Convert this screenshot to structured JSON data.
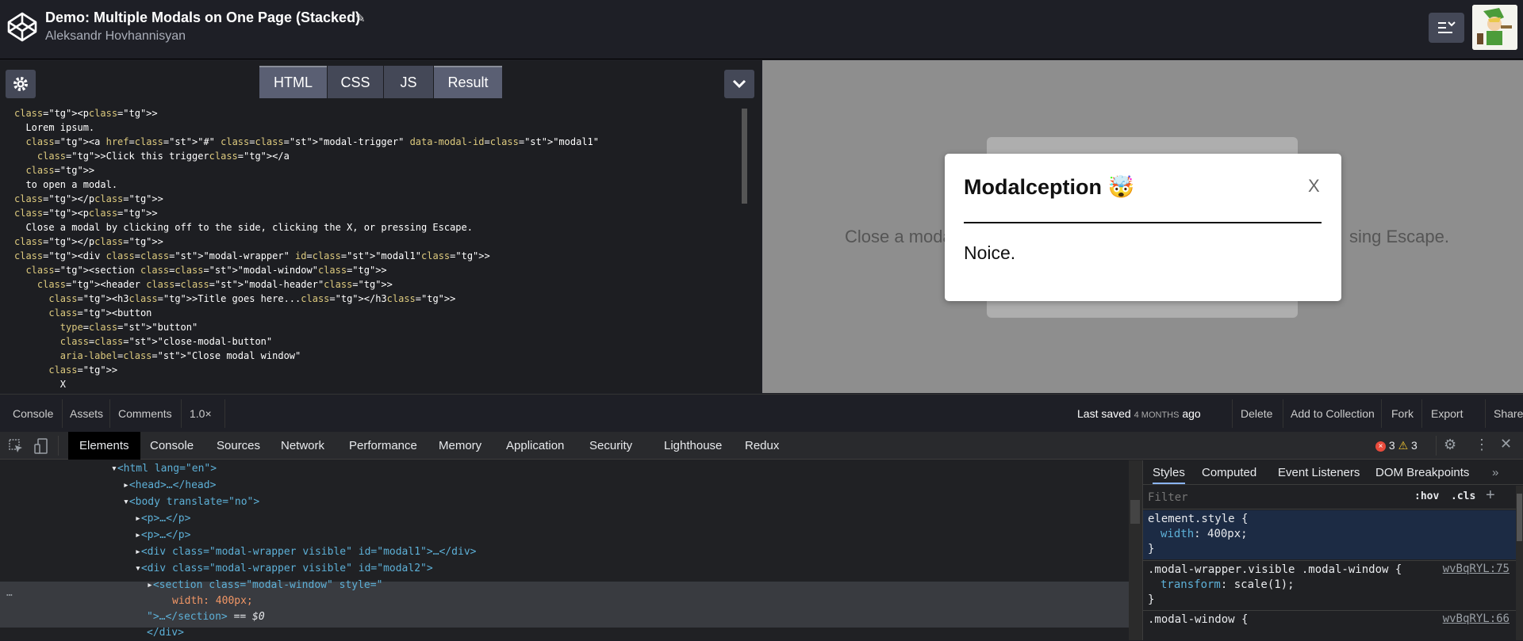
{
  "header": {
    "title": "Demo: Multiple Modals on One Page (Stacked)",
    "author": "Aleksandr Hovhannisyan"
  },
  "editor_tabs": [
    {
      "label": "HTML",
      "active": true
    },
    {
      "label": "CSS",
      "active": false
    },
    {
      "label": "JS",
      "active": false
    },
    {
      "label": "Result",
      "active": true
    }
  ],
  "code_lines": [
    "<p>",
    "  Lorem ipsum.",
    "  <a href=\"#\" class=\"modal-trigger\" data-modal-id=\"modal1\"",
    "    >Click this trigger</a",
    "  >",
    "  to open a modal.",
    "</p>",
    "<p>",
    "  Close a modal by clicking off to the side, clicking the X, or pressing Escape.",
    "</p>",
    "<div class=\"modal-wrapper\" id=\"modal1\">",
    "  <section class=\"modal-window\">",
    "    <header class=\"modal-header\">",
    "      <h3>Title goes here...</h3>",
    "      <button",
    "        type=\"button\"",
    "        class=\"close-modal-button\"",
    "        aria-label=\"Close modal window\"",
    "      >",
    "        X"
  ],
  "preview": {
    "bg_text_left": "Close a moda",
    "bg_text_right": "sing Escape.",
    "modal_title": "Modalception 🤯",
    "modal_close": "X",
    "modal_body": "Noice."
  },
  "bottombar": {
    "console": "Console",
    "assets": "Assets",
    "comments": "Comments",
    "zoom": "1.0×",
    "saved_prefix": "Last saved",
    "saved_time": "4 MONTHS",
    "saved_suffix": "ago",
    "delete": "Delete",
    "add_collection": "Add to Collection",
    "fork": "Fork",
    "export": "Export",
    "share": "Share"
  },
  "devtools": {
    "tabs": [
      "Elements",
      "Console",
      "Sources",
      "Network",
      "Performance",
      "Memory",
      "Application",
      "Security",
      "Lighthouse",
      "Redux"
    ],
    "errors": "3",
    "warnings": "3",
    "style_tabs": [
      "Styles",
      "Computed",
      "Event Listeners",
      "DOM Breakpoints"
    ],
    "filter_placeholder": "Filter",
    "hov": ":hov",
    "cls": ".cls",
    "dom": {
      "html_open": "<html lang=\"en\">",
      "head": "<head>…</head>",
      "body_open": "<body translate=\"no\">",
      "p1": "<p>…</p>",
      "p2": "<p>…</p>",
      "div1_a": "<div class=\"modal-wrapper visible\" id=\"modal1\">",
      "div1_b": "…</div>",
      "div2": "<div class=\"modal-wrapper visible\" id=\"modal2\">",
      "section_a": "<section class=\"modal-window\" style=\"",
      "section_b": "width: 400px;",
      "section_c": "\">…</section>",
      "section_d": "== $0",
      "div_close": "</div>"
    },
    "styles": {
      "r1_sel": "element.style {",
      "r1_prop": "width",
      "r1_val": "400px;",
      "r1_close": "}",
      "r2_sel": ".modal-wrapper.visible .modal-window {",
      "r2_prop": "transform",
      "r2_val": "scale(1);",
      "r2_close": "}",
      "r2_link": "wvBqRYL:75",
      "r3_sel": ".modal-window {",
      "r3_link": "wvBqRYL:66"
    }
  }
}
